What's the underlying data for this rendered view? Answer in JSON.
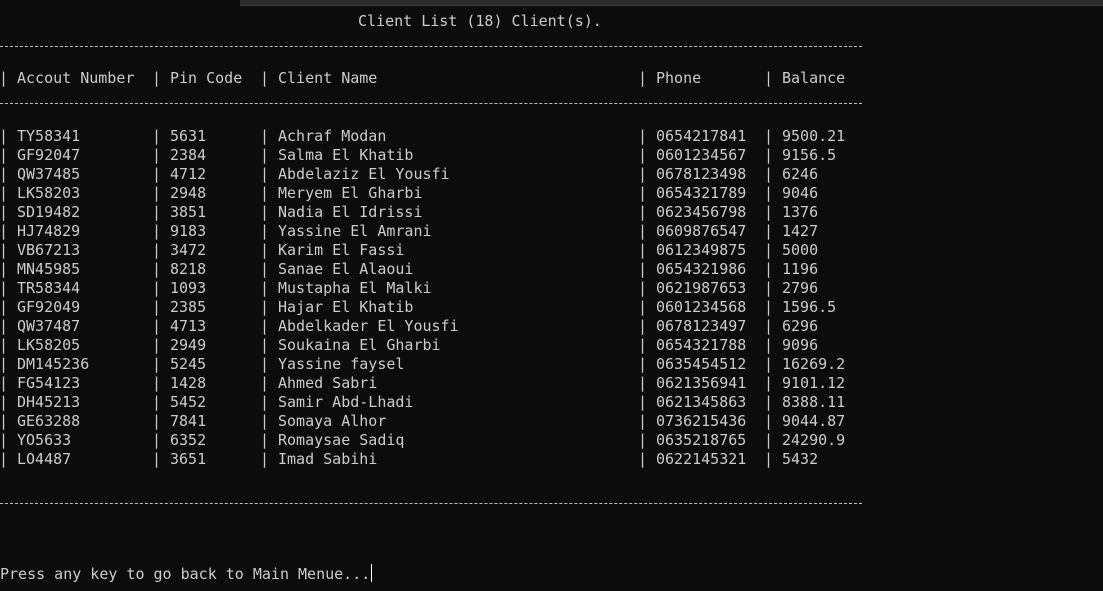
{
  "screen": {
    "title": "Client List (18) Client(s).",
    "prompt": "Press any key to go back to Main Menue..."
  },
  "table": {
    "separator": "|",
    "columns": [
      "Accout Number",
      "Pin Code",
      "Client Name",
      "Phone",
      "Balance"
    ],
    "rows": [
      [
        "TY58341",
        "5631",
        "Achraf Modan",
        "0654217841",
        "9500.21"
      ],
      [
        "GF92047",
        "2384",
        "Salma El Khatib",
        "0601234567",
        "9156.5"
      ],
      [
        "QW37485",
        "4712",
        "Abdelaziz El Yousfi",
        "0678123498",
        "6246"
      ],
      [
        "LK58203",
        "2948",
        "Meryem El Gharbi",
        "0654321789",
        "9046"
      ],
      [
        "SD19482",
        "3851",
        "Nadia El Idrissi",
        "0623456798",
        "1376"
      ],
      [
        "HJ74829",
        "9183",
        "Yassine El Amrani",
        "0609876547",
        "1427"
      ],
      [
        "VB67213",
        "3472",
        "Karim El Fassi",
        "0612349875",
        "5000"
      ],
      [
        "MN45985",
        "8218",
        "Sanae El Alaoui",
        "0654321986",
        "1196"
      ],
      [
        "TR58344",
        "1093",
        "Mustapha El Malki",
        "0621987653",
        "2796"
      ],
      [
        "GF92049",
        "2385",
        "Hajar El Khatib",
        "0601234568",
        "1596.5"
      ],
      [
        "QW37487",
        "4713",
        "Abdelkader El Yousfi",
        "0678123497",
        "6296"
      ],
      [
        "LK58205",
        "2949",
        "Soukaina El Gharbi",
        "0654321788",
        "9096"
      ],
      [
        "DM145236",
        "5245",
        "Yassine faysel",
        "0635454512",
        "16269.2"
      ],
      [
        "FG54123",
        "1428",
        "Ahmed Sabri",
        "0621356941",
        "9101.12"
      ],
      [
        "DH45213",
        "5452",
        "Samir Abd-Lhadi",
        "0621345863",
        "8388.11"
      ],
      [
        "GE63288",
        "7841",
        "Somaya Alhor",
        "0736215436",
        "9044.87"
      ],
      [
        "YO5633",
        "6352",
        "Romaysae Sadiq",
        "0635218765",
        "24290.9"
      ],
      [
        "LO4487",
        "3651",
        "Imad Sabihi",
        "0622145321",
        "5432"
      ]
    ]
  }
}
